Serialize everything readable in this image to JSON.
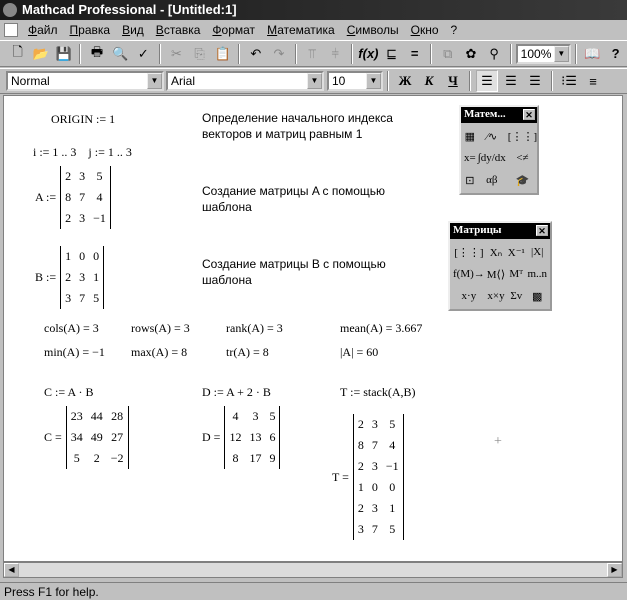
{
  "window": {
    "title": "Mathcad Professional - [Untitled:1]"
  },
  "menu": [
    "Файл",
    "Правка",
    "Вид",
    "Вставка",
    "Формат",
    "Математика",
    "Символы",
    "Окно",
    "?"
  ],
  "toolbar": {
    "zoom": "100%"
  },
  "format_bar": {
    "style": "Normal",
    "font": "Arial",
    "size": "10",
    "bold": "Ж",
    "italic": "К",
    "underline": "Ч"
  },
  "doc": {
    "origin": "ORIGIN := 1",
    "origin_comment": "Определение начального индекса векторов и матриц равным 1",
    "ranges": "i := 1 .. 3    j := 1 .. 3",
    "a_comment": "Создание матрицы A с помощью шаблона",
    "b_comment": "Создание матрицы B с помощью шаблона",
    "A": {
      "label": "A :=",
      "rows": [
        [
          "2",
          "3",
          "5"
        ],
        [
          "8",
          "7",
          "4"
        ],
        [
          "2",
          "3",
          "−1"
        ]
      ]
    },
    "B": {
      "label": "B :=",
      "rows": [
        [
          "1",
          "0",
          "0"
        ],
        [
          "2",
          "3",
          "1"
        ],
        [
          "3",
          "7",
          "5"
        ]
      ]
    },
    "C": {
      "label": "C =",
      "rows": [
        [
          "23",
          "44",
          "28"
        ],
        [
          "34",
          "49",
          "27"
        ],
        [
          "5",
          "2",
          "−2"
        ]
      ]
    },
    "D": {
      "label": "D =",
      "rows": [
        [
          "4",
          "3",
          "5"
        ],
        [
          "12",
          "13",
          "6"
        ],
        [
          "8",
          "17",
          "9"
        ]
      ]
    },
    "T": {
      "label": "T =",
      "rows": [
        [
          "2",
          "3",
          "5"
        ],
        [
          "8",
          "7",
          "4"
        ],
        [
          "2",
          "3",
          "−1"
        ],
        [
          "1",
          "0",
          "0"
        ],
        [
          "2",
          "3",
          "1"
        ],
        [
          "3",
          "7",
          "5"
        ]
      ]
    },
    "funcs": [
      "cols(A) = 3",
      "rows(A) = 3",
      "rank(A) = 3",
      "mean(A) = 3.667",
      "min(A) = −1",
      "max(A) = 8",
      "tr(A) = 8",
      "|A| = 60"
    ],
    "defs": [
      "C := A · B",
      "D := A + 2 · B",
      "T := stack(A,B)"
    ]
  },
  "palette_math": {
    "title": "Матем...",
    "buttons": [
      "▦",
      "⁄∿",
      "[⋮⋮]",
      "x=",
      "∫dy/dx",
      "<≠",
      "⊡",
      "αβ",
      "🎓"
    ]
  },
  "palette_matrix": {
    "title": "Матрицы",
    "buttons": [
      "[⋮⋮]",
      "Xₙ",
      "X⁻¹",
      "|X|",
      "f(M)→",
      "M⟨⟩",
      "Mᵀ",
      "m..n",
      "x·y",
      "x×y",
      "Σv",
      "▩"
    ]
  },
  "status": "Press F1 for help."
}
